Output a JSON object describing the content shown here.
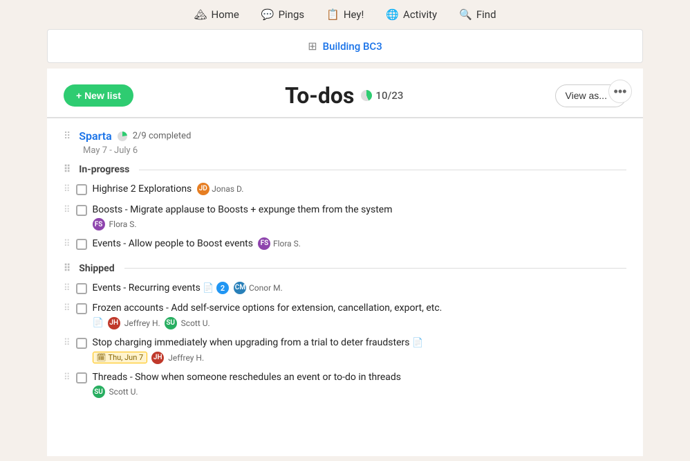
{
  "nav": {
    "items": [
      {
        "id": "home",
        "label": "Home",
        "icon": "home-icon"
      },
      {
        "id": "pings",
        "label": "Pings",
        "icon": "pings-icon"
      },
      {
        "id": "hey",
        "label": "Hey!",
        "icon": "hey-icon"
      },
      {
        "id": "activity",
        "label": "Activity",
        "icon": "activity-icon"
      },
      {
        "id": "find",
        "label": "Find",
        "icon": "find-icon"
      }
    ]
  },
  "project_bar": {
    "icon": "grid-icon",
    "label": "Building BC3",
    "link": "#"
  },
  "toolbar": {
    "new_list_label": "+ New list",
    "title": "To-dos",
    "progress_count": "10/23",
    "view_as_label": "View as...",
    "more_options_label": "•••"
  },
  "list": {
    "project_name": "Sparta",
    "project_completed": "2/9 completed",
    "project_date_range": "May 7 - July 6",
    "groups": [
      {
        "id": "in-progress",
        "label": "In-progress",
        "items": [
          {
            "id": "item1",
            "text": "Highrise 2 Explorations",
            "assignee": "Jonas D.",
            "avatar_color": "#e67e22",
            "avatar_initials": "JD",
            "has_doc": false,
            "badge_count": null,
            "date_badge": null
          },
          {
            "id": "item2",
            "text": "Boosts - Migrate applause to Boosts + expunge them from the system",
            "assignee": "Flora S.",
            "avatar_color": "#8e44ad",
            "avatar_initials": "FS",
            "has_doc": false,
            "badge_count": null,
            "date_badge": null
          },
          {
            "id": "item3",
            "text": "Events - Allow people to Boost events",
            "assignee": "Flora S.",
            "avatar_color": "#8e44ad",
            "avatar_initials": "FS",
            "has_doc": false,
            "badge_count": null,
            "date_badge": null
          }
        ]
      },
      {
        "id": "shipped",
        "label": "Shipped",
        "items": [
          {
            "id": "item4",
            "text": "Events - Recurring events",
            "assignee": "Conor M.",
            "avatar_color": "#2980b9",
            "avatar_initials": "CM",
            "has_doc": true,
            "badge_count": 2,
            "date_badge": null
          },
          {
            "id": "item5",
            "text": "Frozen accounts - Add self-service options for extension, cancellation, export, etc.",
            "assignee": "Jeffrey H.",
            "assignee2": "Scott U.",
            "avatar_color": "#c0392b",
            "avatar_initials": "JH",
            "avatar2_color": "#27ae60",
            "avatar2_initials": "SU",
            "has_doc": true,
            "badge_count": null,
            "date_badge": null
          },
          {
            "id": "item6",
            "text": "Stop charging immediately when upgrading from a trial to deter fraudsters",
            "assignee": "Jeffrey H.",
            "avatar_color": "#c0392b",
            "avatar_initials": "JH",
            "has_doc": true,
            "badge_count": null,
            "date_badge": "Thu, Jun 7"
          },
          {
            "id": "item7",
            "text": "Threads - Show when someone reschedules an event or to-do in threads",
            "assignee": "Scott U.",
            "avatar_color": "#27ae60",
            "avatar_initials": "SU",
            "has_doc": false,
            "badge_count": null,
            "date_badge": null
          }
        ]
      }
    ]
  }
}
